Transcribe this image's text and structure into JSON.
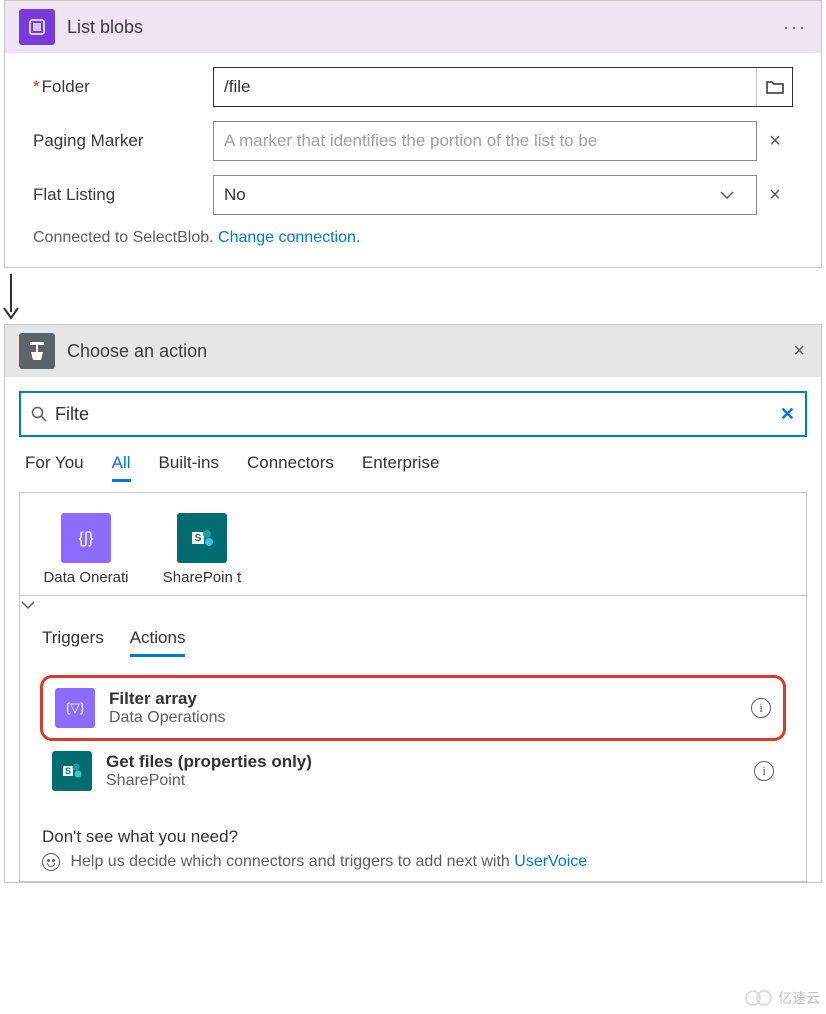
{
  "listBlobs": {
    "title": "List blobs",
    "fields": {
      "folder": {
        "label": "Folder",
        "value": "/file"
      },
      "pagingMarker": {
        "label": "Paging Marker",
        "placeholder": "A marker that identifies the portion of the list to be"
      },
      "flatListing": {
        "label": "Flat Listing",
        "value": "No"
      }
    },
    "connectedText": "Connected to SelectBlob. ",
    "changeLink": "Change connection."
  },
  "chooseAction": {
    "title": "Choose an action",
    "searchValue": "Filte",
    "tabs": [
      "For You",
      "All",
      "Built-ins",
      "Connectors",
      "Enterprise"
    ],
    "activeTab": "All",
    "connectors": [
      {
        "label": "Data Onerati",
        "icon": "purple"
      },
      {
        "label": "SharePoin t",
        "icon": "sp"
      }
    ],
    "subTabs": [
      "Triggers",
      "Actions"
    ],
    "activeSubTab": "Actions",
    "actions": [
      {
        "title": "Filter array",
        "subtitle": "Data Operations",
        "icon": "purple",
        "highlight": true
      },
      {
        "title": "Get files (properties only)",
        "subtitle": "SharePoint",
        "icon": "sp",
        "highlight": false
      }
    ],
    "footer": {
      "question": "Don't see what you need?",
      "helpText": "Help us decide which connectors and triggers to add next with ",
      "linkText": "UserVoice"
    }
  },
  "watermark": "亿速云"
}
